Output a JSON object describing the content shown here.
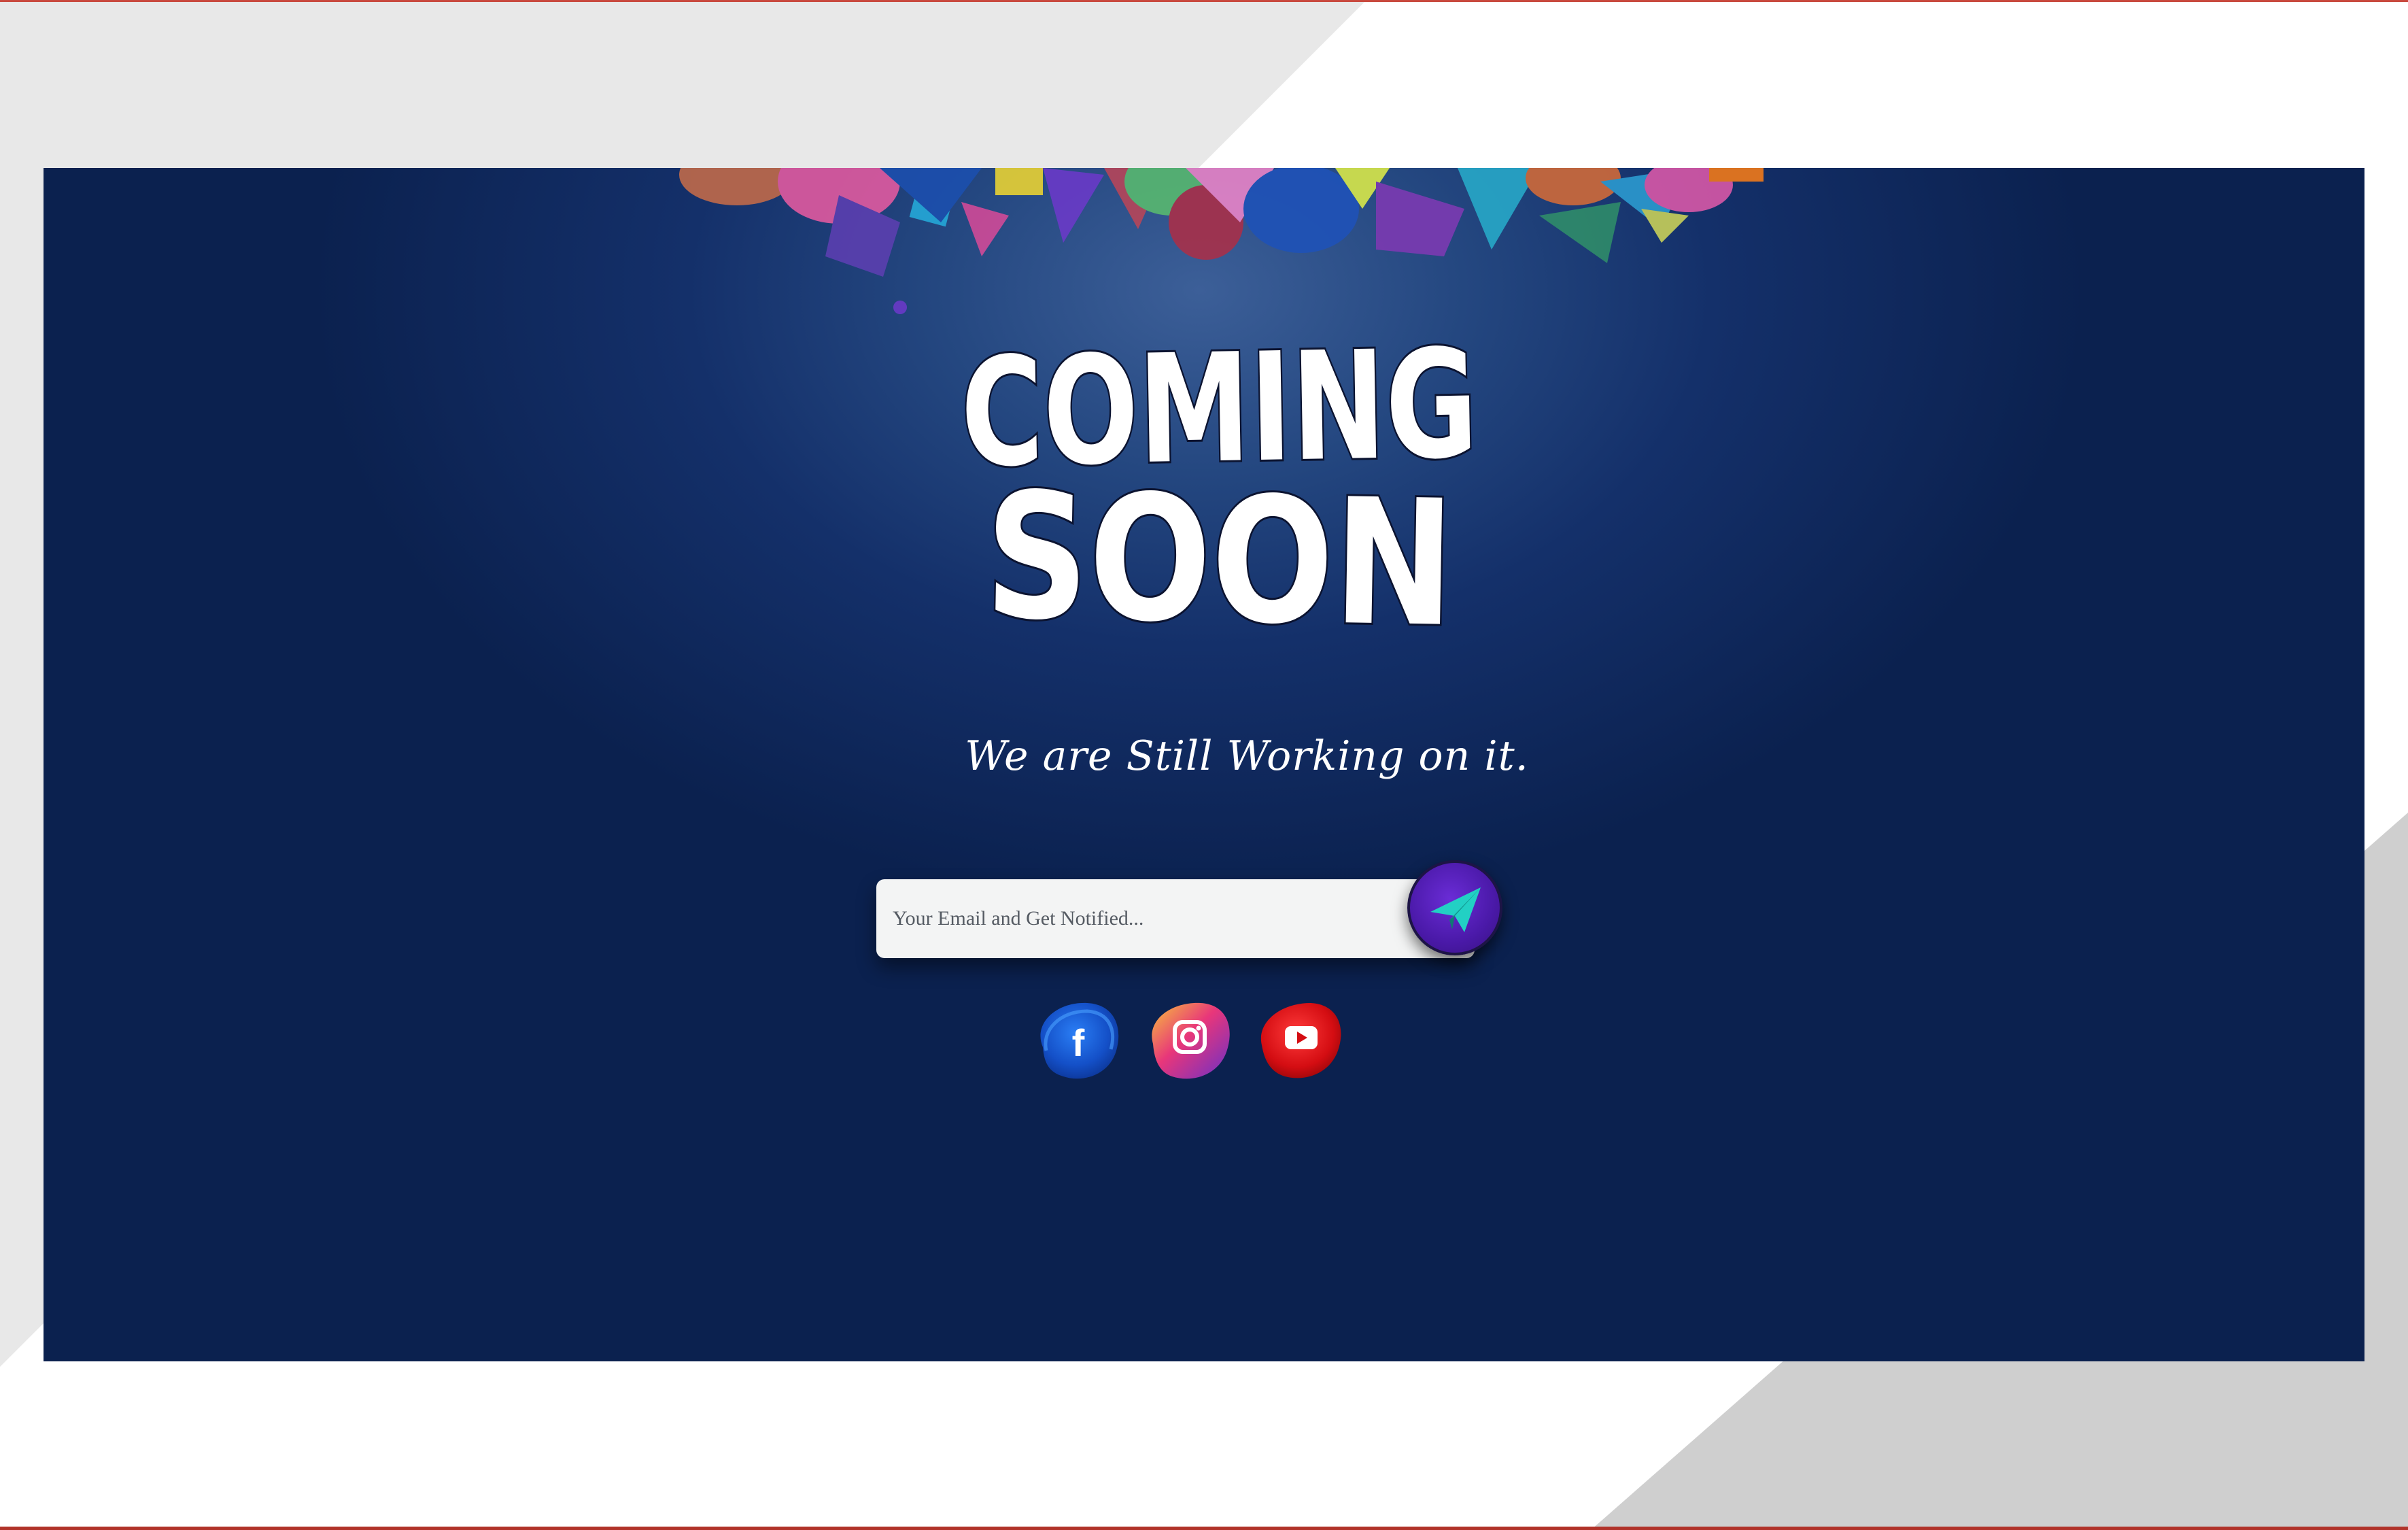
{
  "page": {
    "title_line1": "COMING",
    "title_line2": "SOON",
    "tagline": "We are Still Working on it."
  },
  "subscribe": {
    "email_placeholder": "Your Email and Get Notified...",
    "email_value": "",
    "submit_icon": "paper-plane-icon"
  },
  "social": [
    {
      "name": "facebook",
      "icon": "facebook-icon",
      "glyph": "f",
      "color": "#1b57d6"
    },
    {
      "name": "instagram",
      "icon": "instagram-icon",
      "color": "#e0416e"
    },
    {
      "name": "youtube",
      "icon": "youtube-icon",
      "color": "#e01414"
    }
  ],
  "colors": {
    "background": "#14306a",
    "accent": "#5a21c2",
    "plane": "#1ec8c0"
  }
}
